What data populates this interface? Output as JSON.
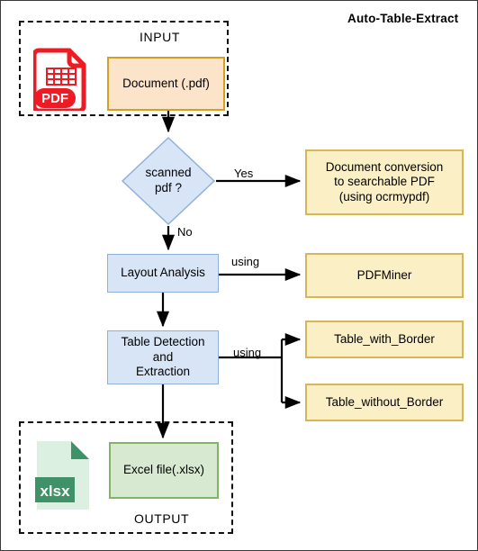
{
  "title": "Auto-Table-Extract",
  "groups": {
    "input": {
      "label": "INPUT"
    },
    "output": {
      "label": "OUTPUT"
    }
  },
  "nodes": {
    "document_pdf": "Document (.pdf)",
    "scanned_decision": "scanned\npdf ?",
    "doc_conversion": "Document conversion\nto searchable PDF\n(using ocrmypdf)",
    "layout_analysis": "Layout Analysis",
    "pdfminer": "PDFMiner",
    "table_detection": "Table Detection\nand\nExtraction",
    "table_with_border": "Table_with_Border",
    "table_without_border": "Table_without_Border",
    "excel_file": "Excel file(.xlsx)"
  },
  "edges": {
    "yes": "Yes",
    "no": "No",
    "using_layout": "using",
    "using_table": "using"
  },
  "icons": {
    "pdf_file": {
      "name": "pdf-file-icon",
      "badge": "PDF"
    },
    "xlsx_file": {
      "name": "xlsx-file-icon",
      "badge": "xlsx"
    }
  },
  "colors": {
    "peach_fill": "#fce4ca",
    "peach_border": "#d6a01e",
    "blue_fill": "#d8e5f7",
    "blue_border": "#8fb0dd",
    "yellow_fill": "#fbefc6",
    "yellow_border": "#d6b656",
    "green_fill": "#d7ead1",
    "green_border": "#82b366",
    "pdf_red": "#ed1c24",
    "xlsx_green_light": "#dbf0e1",
    "xlsx_green_dark": "#3f9268",
    "edge_stroke": "#000000"
  }
}
